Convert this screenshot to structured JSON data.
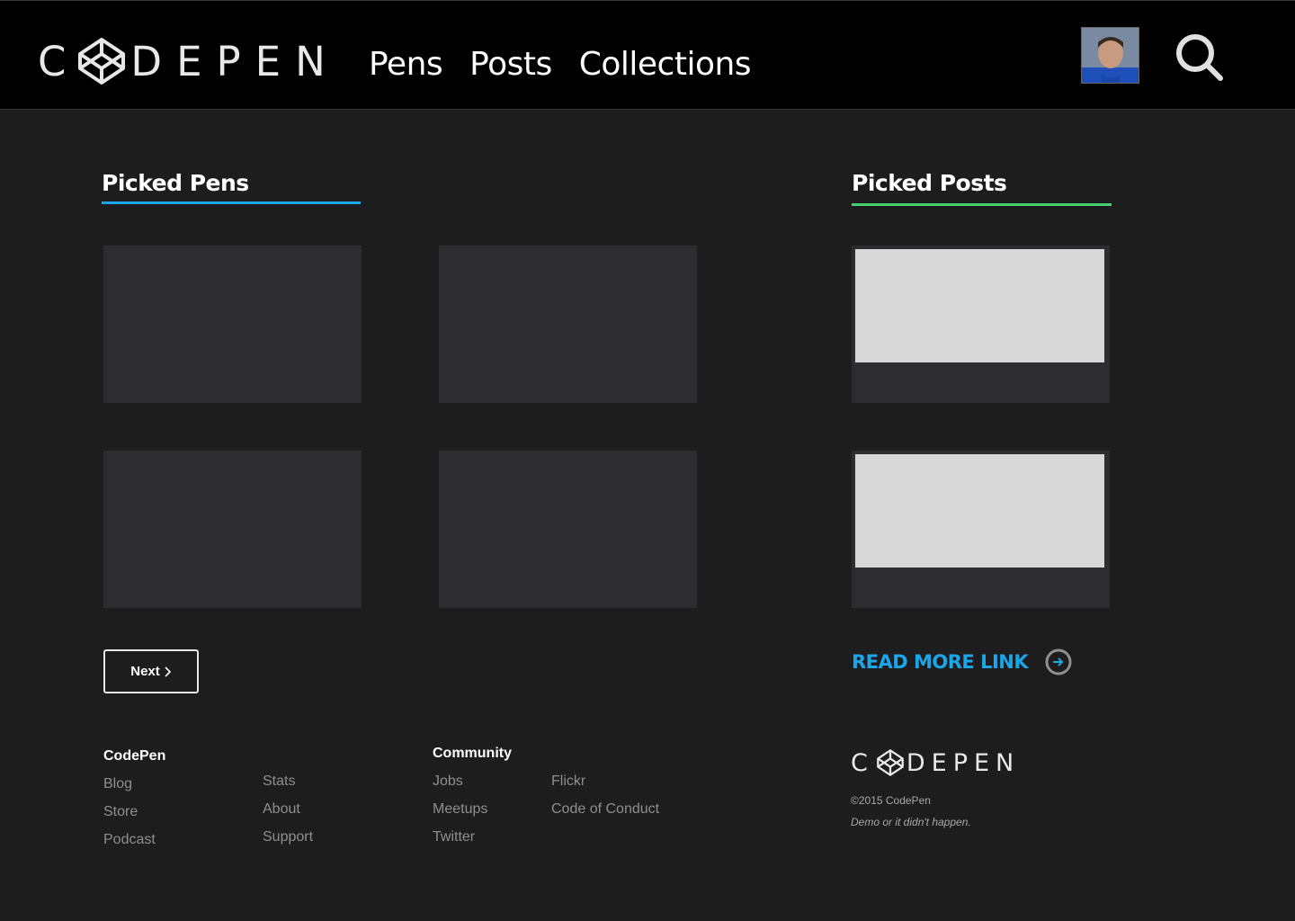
{
  "header": {
    "logo_text_first": "C",
    "logo_text_rest": "DEPEN",
    "nav": [
      {
        "label": "Pens"
      },
      {
        "label": "Posts"
      },
      {
        "label": "Collections"
      }
    ],
    "avatar_icon": "user-avatar",
    "search_icon": "search-icon"
  },
  "picked_pens": {
    "title": "Picked Pens",
    "accent_color": "#1aa6e8",
    "next_label": "Next",
    "next_icon": "chevron-right-icon"
  },
  "picked_posts": {
    "title": "Picked Posts",
    "accent_color": "#47cf73",
    "read_more_label": "READ MORE LINK",
    "read_more_icon": "arrow-right-circle-icon",
    "link_color": "#1aa6e8"
  },
  "footer": {
    "codepen": {
      "heading": "CodePen",
      "col1": [
        "Blog",
        "Store",
        "Podcast"
      ],
      "col2": [
        "Stats",
        "About",
        "Support"
      ]
    },
    "community": {
      "heading": "Community",
      "col1": [
        "Jobs",
        "Meetups",
        "Twitter"
      ],
      "col2": [
        "Flickr",
        "Code of Conduct"
      ]
    },
    "logo_text_first": "C",
    "logo_text_rest": "DEPEN",
    "copyright": "©2015 CodePen",
    "tagline": "Demo or it didn't happen."
  }
}
